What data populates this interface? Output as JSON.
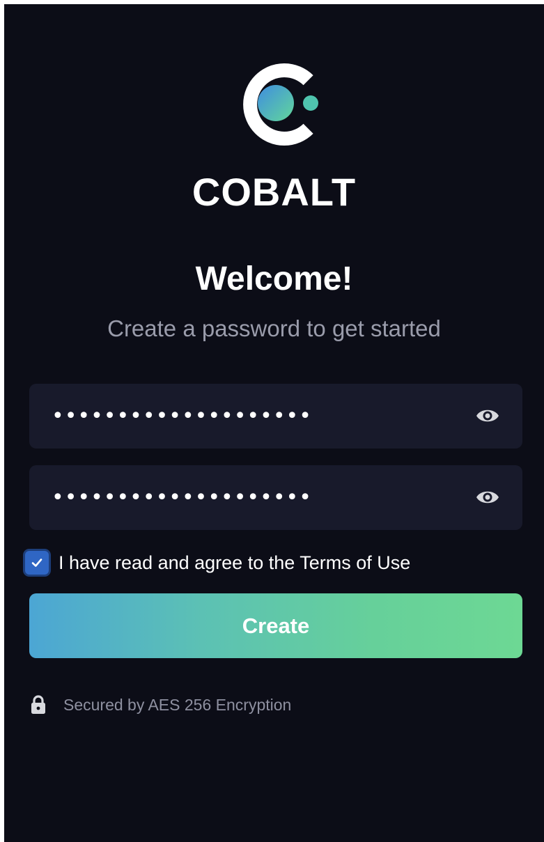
{
  "brand": {
    "name": "COBALT",
    "logo_icon": "cobalt-logo-icon"
  },
  "welcome": {
    "title": "Welcome!",
    "subtitle": "Create a password to get started"
  },
  "password_field": {
    "value": "••••••••••••••••••••",
    "icon": "eye-icon"
  },
  "confirm_field": {
    "value": "••••••••••••••••••••",
    "icon": "eye-icon"
  },
  "terms": {
    "checked": true,
    "label": "I have read and agree to the Terms of Use"
  },
  "create_button": {
    "label": "Create",
    "gradient_start": "#4ca6d4",
    "gradient_end": "#6dd894"
  },
  "security_note": {
    "icon": "lock-icon",
    "text": "Secured by AES 256 Encryption"
  },
  "colors": {
    "background": "#0c0d17",
    "field_background": "#181a2b",
    "checkbox": "#2f66c4"
  }
}
